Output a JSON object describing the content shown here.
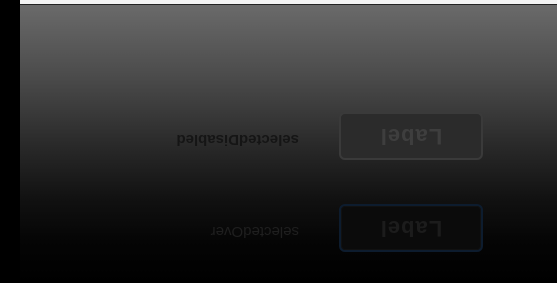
{
  "states": [
    {
      "id": "selectedOver",
      "state_label": "selectedOver",
      "button_label": "Label"
    },
    {
      "id": "selectedDisabled",
      "state_label": "selectedDisabled",
      "button_label": "Label"
    }
  ],
  "colors": {
    "panel_top": "#6a6a6a",
    "panel_bottom": "#000000",
    "over_button_border": "#0d1c2e",
    "disabled_button_bg": "#2b2b2b"
  }
}
